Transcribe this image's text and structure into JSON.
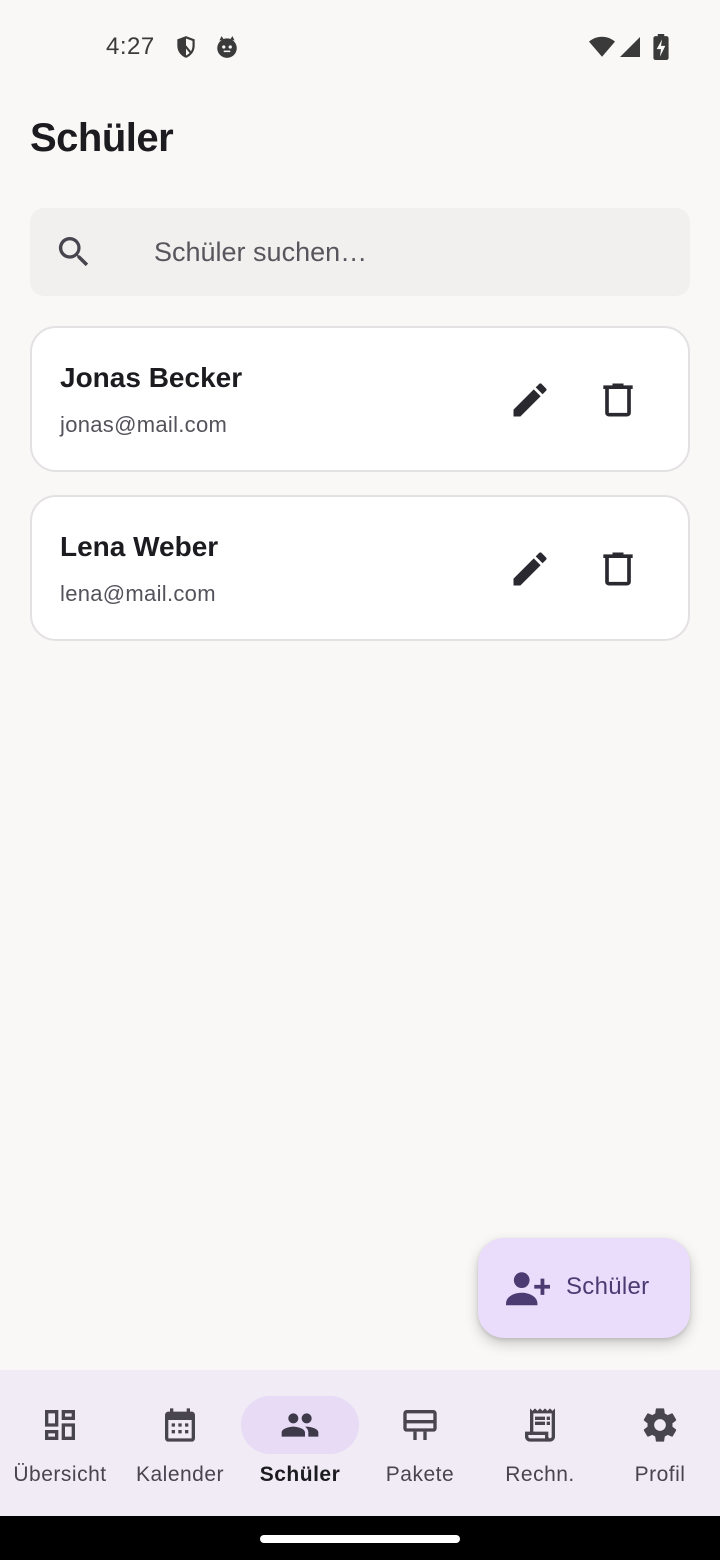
{
  "status_bar": {
    "time": "4:27",
    "icons": [
      "vpn-shield-icon",
      "notification-cat-icon",
      "wifi-icon",
      "cellular-signal-icon",
      "battery-charging-icon"
    ]
  },
  "page": {
    "title": "Schüler"
  },
  "search": {
    "placeholder": "Schüler suchen…",
    "value": "",
    "icon": "search-icon"
  },
  "students": [
    {
      "name": "Jonas Becker",
      "email": "jonas@mail.com"
    },
    {
      "name": "Lena Weber",
      "email": "lena@mail.com"
    }
  ],
  "card_actions": {
    "edit_icon": "pencil-icon",
    "delete_icon": "trash-icon"
  },
  "fab": {
    "label": "Schüler",
    "icon": "person-add-icon",
    "color": "#eadcfb"
  },
  "bottom_nav": {
    "items": [
      {
        "label": "Übersicht",
        "icon": "dashboard-icon",
        "active": false
      },
      {
        "label": "Kalender",
        "icon": "calendar-icon",
        "active": false
      },
      {
        "label": "Schüler",
        "icon": "people-icon",
        "active": true
      },
      {
        "label": "Pakete",
        "icon": "package-icon",
        "active": false
      },
      {
        "label": "Rechn.",
        "icon": "receipt-icon",
        "active": false
      },
      {
        "label": "Profil",
        "icon": "gear-icon",
        "active": false
      }
    ]
  },
  "colors": {
    "background": "#f9f8f6",
    "nav_background": "#f0ebf4",
    "active_indicator": "#e7dbf6",
    "icon": "#49454f"
  }
}
